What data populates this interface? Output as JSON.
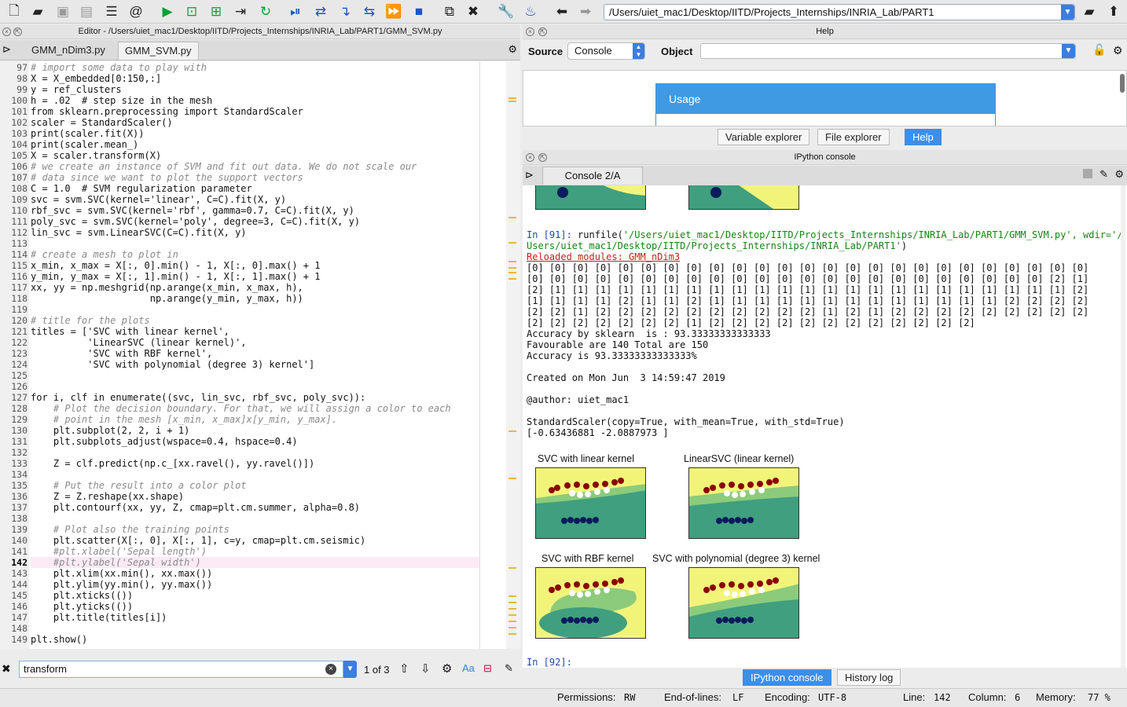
{
  "toolbar": {
    "icons": [
      "new-file-icon",
      "open-folder-icon",
      "save-icon",
      "save-all-icon",
      "list-icon",
      "at-icon",
      "run-icon",
      "run-cell-icon",
      "run-cell-advance-icon",
      "run-selection-icon",
      "rerun-icon",
      "debug-icon",
      "step-icon",
      "step-into-icon",
      "step-return-icon",
      "continue-icon",
      "stop-icon",
      "maximize-icon",
      "fullscreen-icon",
      "wrench-icon",
      "python-icon",
      "back-arrow-icon",
      "forward-arrow-icon",
      "browse-folder-icon",
      "parent-dir-icon"
    ],
    "path": "/Users/uiet_mac1/Desktop/IITD/Projects_Internships/INRIA_Lab/PART1"
  },
  "editor": {
    "title": "Editor - /Users/uiet_mac1/Desktop/IITD/Projects_Internships/INRIA_Lab/PART1/GMM_SVM.py",
    "tabs": [
      "GMM_nDim3.py",
      "GMM_SVM.py"
    ],
    "active_tab": "GMM_SVM.py",
    "lines": [
      {
        "n": "97",
        "t": "# import some data to play with"
      },
      {
        "n": "98",
        "t": "X = X_embedded[0:150,:]"
      },
      {
        "n": "99",
        "t": "y = ref_clusters"
      },
      {
        "n": "100",
        "t": "h = .02  # step size in the mesh"
      },
      {
        "n": "101",
        "t": "from sklearn.preprocessing import StandardScaler"
      },
      {
        "n": "102",
        "t": "scaler = StandardScaler()"
      },
      {
        "n": "103",
        "t": "print(scaler.fit(X))"
      },
      {
        "n": "104",
        "t": "print(scaler.mean_)"
      },
      {
        "n": "105",
        "t": "X = scaler.transform(X)"
      },
      {
        "n": "106",
        "t": "# we create an instance of SVM and fit out data. We do not scale our"
      },
      {
        "n": "107",
        "t": "# data since we want to plot the support vectors"
      },
      {
        "n": "108",
        "t": "C = 1.0  # SVM regularization parameter"
      },
      {
        "n": "109",
        "t": "svc = svm.SVC(kernel='linear', C=C).fit(X, y)"
      },
      {
        "n": "110",
        "t": "rbf_svc = svm.SVC(kernel='rbf', gamma=0.7, C=C).fit(X, y)"
      },
      {
        "n": "111",
        "t": "poly_svc = svm.SVC(kernel='poly', degree=3, C=C).fit(X, y)"
      },
      {
        "n": "112",
        "t": "lin_svc = svm.LinearSVC(C=C).fit(X, y)"
      },
      {
        "n": "113",
        "t": ""
      },
      {
        "n": "114",
        "t": "# create a mesh to plot in"
      },
      {
        "n": "115",
        "t": "x_min, x_max = X[:, 0].min() - 1, X[:, 0].max() + 1"
      },
      {
        "n": "116",
        "t": "y_min, y_max = X[:, 1].min() - 1, X[:, 1].max() + 1"
      },
      {
        "n": "117",
        "t": "xx, yy = np.meshgrid(np.arange(x_min, x_max, h),"
      },
      {
        "n": "118",
        "t": "                     np.arange(y_min, y_max, h))"
      },
      {
        "n": "119",
        "t": ""
      },
      {
        "n": "120",
        "t": "# title for the plots"
      },
      {
        "n": "121",
        "t": "titles = ['SVC with linear kernel',"
      },
      {
        "n": "122",
        "t": "          'LinearSVC (linear kernel)',"
      },
      {
        "n": "123",
        "t": "          'SVC with RBF kernel',"
      },
      {
        "n": "124",
        "t": "          'SVC with polynomial (degree 3) kernel']"
      },
      {
        "n": "125",
        "t": ""
      },
      {
        "n": "126",
        "t": ""
      },
      {
        "n": "127",
        "t": "for i, clf in enumerate((svc, lin_svc, rbf_svc, poly_svc)):"
      },
      {
        "n": "128",
        "t": "    # Plot the decision boundary. For that, we will assign a color to each"
      },
      {
        "n": "129",
        "t": "    # point in the mesh [x_min, x_max]x[y_min, y_max]."
      },
      {
        "n": "130",
        "t": "    plt.subplot(2, 2, i + 1)"
      },
      {
        "n": "131",
        "t": "    plt.subplots_adjust(wspace=0.4, hspace=0.4)"
      },
      {
        "n": "132",
        "t": ""
      },
      {
        "n": "133",
        "t": "    Z = clf.predict(np.c_[xx.ravel(), yy.ravel()])"
      },
      {
        "n": "134",
        "t": ""
      },
      {
        "n": "135",
        "t": "    # Put the result into a color plot"
      },
      {
        "n": "136",
        "t": "    Z = Z.reshape(xx.shape)"
      },
      {
        "n": "137",
        "t": "    plt.contourf(xx, yy, Z, cmap=plt.cm.summer, alpha=0.8)"
      },
      {
        "n": "138",
        "t": ""
      },
      {
        "n": "139",
        "t": "    # Plot also the training points"
      },
      {
        "n": "140",
        "t": "    plt.scatter(X[:, 0], X[:, 1], c=y, cmap=plt.cm.seismic)"
      },
      {
        "n": "141",
        "t": "    #plt.xlabel('Sepal length')"
      },
      {
        "n": "142",
        "t": "    #plt.ylabel('Sepal width')"
      },
      {
        "n": "143",
        "t": "    plt.xlim(xx.min(), xx.max())"
      },
      {
        "n": "144",
        "t": "    plt.ylim(yy.min(), yy.max())"
      },
      {
        "n": "145",
        "t": "    plt.xticks(())"
      },
      {
        "n": "146",
        "t": "    plt.yticks(())"
      },
      {
        "n": "147",
        "t": "    plt.title(titles[i])"
      },
      {
        "n": "148",
        "t": ""
      },
      {
        "n": "149",
        "t": "plt.show()"
      }
    ],
    "current_line": "142"
  },
  "find": {
    "value": "transform",
    "count": "1 of 3",
    "case_label": "Aa"
  },
  "help": {
    "title": "Help",
    "source_label": "Source",
    "source_value": "Console",
    "object_label": "Object",
    "usage_title": "Usage",
    "tabs": [
      "Variable explorer",
      "File explorer",
      "Help"
    ],
    "active_tab": "Help"
  },
  "console": {
    "title": "IPython console",
    "tab": "Console 2/A",
    "in91_prefix": "In [91]: ",
    "in91_cmd": "runfile(",
    "in91_path1": "'/Users/uiet_mac1/Desktop/IITD/Projects_Internships/INRIA_Lab/PART1/GMM_SVM.py', wdir='/",
    "in91_path2": "Users/uiet_mac1/Desktop/IITD/Projects_Internships/INRIA_Lab/PART1'",
    "in91_close": ")",
    "reloaded": "Reloaded modules: GMM_nDim3",
    "output_rows": [
      "[0] [0] [0] [0] [0] [0] [0] [0] [0] [0] [0] [0] [0] [0] [0] [0] [0] [0] [0] [0] [0] [0] [0] [0] [0]",
      "[0] [0] [0] [0] [0] [0] [0] [0] [0] [0] [0] [0] [0] [0] [0] [0] [0] [0] [0] [0] [0] [0] [0] [2] [1]",
      "[2] [1] [1] [1] [1] [1] [1] [1] [1] [1] [1] [1] [1] [1] [1] [1] [1] [1] [1] [1] [1] [1] [1] [1] [2]",
      "[1] [1] [1] [1] [2] [1] [1] [2] [1] [1] [1] [1] [1] [1] [1] [1] [1] [1] [1] [1] [1] [2] [2] [2] [2]",
      "[2] [2] [1] [2] [2] [2] [2] [2] [2] [2] [2] [2] [2] [1] [2] [1] [2] [2] [2] [2] [2] [2] [2] [2] [2]",
      "[2] [2] [2] [2] [2] [2] [2] [1] [2] [2] [2] [2] [2] [2] [2] [2] [2] [2] [2] [2]"
    ],
    "accuracy_sklearn": "Accuracy by sklearn  is : 93.33333333333333",
    "favourable": "Favourable are 140 Total are 150",
    "accuracy": "Accuracy is 93.33333333333333%",
    "created": "Created on Mon Jun  3 14:59:47 2019",
    "author": "@author: uiet_mac1",
    "scaler_repr": "StandardScaler(copy=True, with_mean=True, with_std=True)",
    "mean_repr": "[-0.63436881 -2.0887973 ]",
    "plot_titles": [
      "SVC with linear kernel",
      "LinearSVC (linear kernel)",
      "SVC with RBF kernel",
      "SVC with polynomial (degree 3) kernel"
    ],
    "prompt": "In [92]:",
    "bottom_tabs": [
      "IPython console",
      "History log"
    ],
    "active_bottom_tab": "IPython console"
  },
  "status": {
    "permissions_label": "Permissions:",
    "permissions": "RW",
    "eol_label": "End-of-lines:",
    "eol": "LF",
    "encoding_label": "Encoding:",
    "encoding": "UTF-8",
    "line_label": "Line:",
    "line": "142",
    "column_label": "Column:",
    "column": "6",
    "memory_label": "Memory:",
    "memory": "77 %"
  },
  "colors": {
    "accent": "#3d8ee8",
    "plot_yellow": "#f2f47a",
    "plot_teal": "#3f9f7f",
    "plot_green": "#8ccb7b",
    "dot_red": "#8b0000",
    "dot_navy": "#0b1a5c"
  }
}
